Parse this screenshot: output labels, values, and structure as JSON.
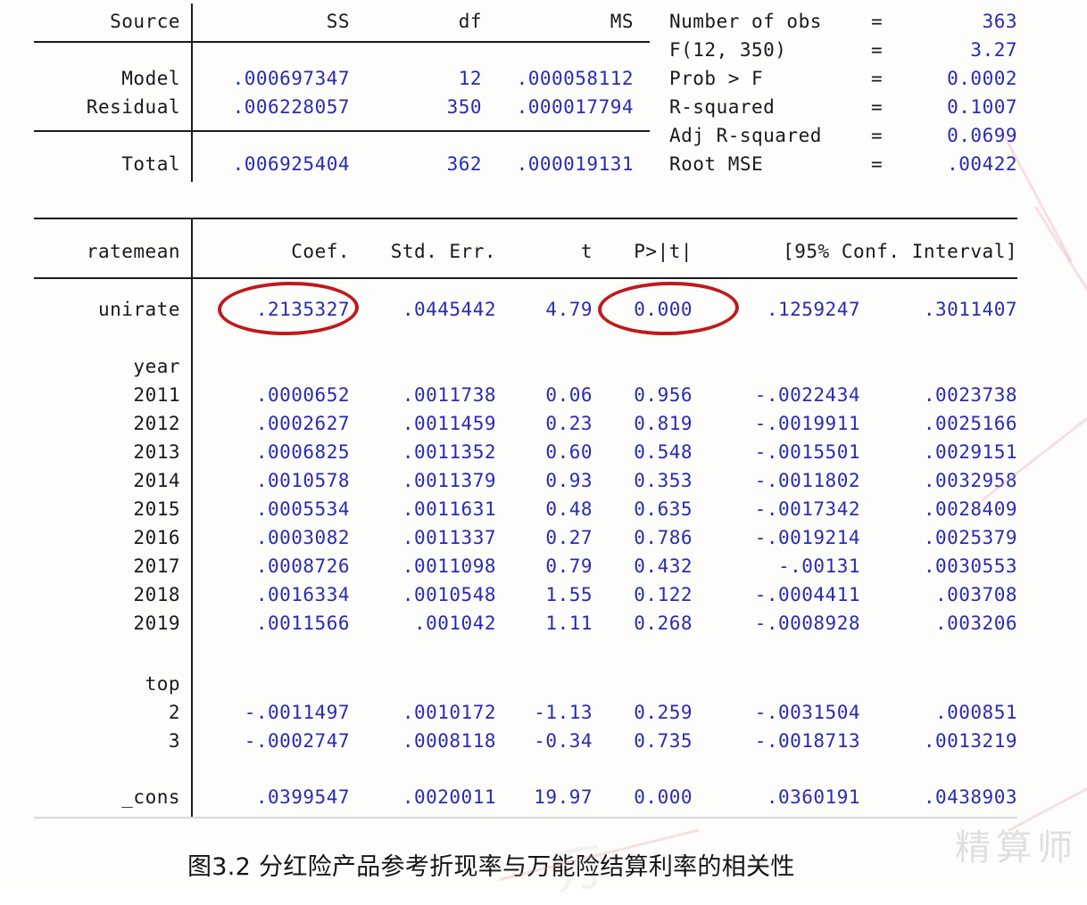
{
  "anova": {
    "headers": [
      "Source",
      "SS",
      "df",
      "MS"
    ],
    "rows": [
      {
        "source": "Model",
        "ss": ".000697347",
        "df": "12",
        "ms": ".000058112"
      },
      {
        "source": "Residual",
        "ss": ".006228057",
        "df": "350",
        "ms": ".000017794"
      },
      {
        "source": "Total",
        "ss": ".006925404",
        "df": "362",
        "ms": ".000019131"
      }
    ]
  },
  "stats": [
    {
      "label": "Number of obs",
      "eq": "=",
      "value": "363"
    },
    {
      "label": "F(12, 350)",
      "eq": "=",
      "value": "3.27"
    },
    {
      "label": "Prob > F",
      "eq": "=",
      "value": "0.0002"
    },
    {
      "label": "R-squared",
      "eq": "=",
      "value": "0.1007"
    },
    {
      "label": "Adj R-squared",
      "eq": "=",
      "value": "0.0699"
    },
    {
      "label": "Root MSE",
      "eq": "=",
      "value": ".00422"
    }
  ],
  "coef_table": {
    "depvar": "ratemean",
    "headers": [
      "Coef.",
      "Std. Err.",
      "t",
      "P>|t|",
      "[95% Conf. Interval]"
    ],
    "rows": [
      {
        "term": "unirate",
        "coef": ".2135327",
        "se": ".0445442",
        "t": "4.79",
        "p": "0.000",
        "ci_lo": ".1259247",
        "ci_hi": ".3011407"
      },
      {
        "term": "year",
        "group": true
      },
      {
        "term": "2011",
        "coef": ".0000652",
        "se": ".0011738",
        "t": "0.06",
        "p": "0.956",
        "ci_lo": "-.0022434",
        "ci_hi": ".0023738"
      },
      {
        "term": "2012",
        "coef": ".0002627",
        "se": ".0011459",
        "t": "0.23",
        "p": "0.819",
        "ci_lo": "-.0019911",
        "ci_hi": ".0025166"
      },
      {
        "term": "2013",
        "coef": ".0006825",
        "se": ".0011352",
        "t": "0.60",
        "p": "0.548",
        "ci_lo": "-.0015501",
        "ci_hi": ".0029151"
      },
      {
        "term": "2014",
        "coef": ".0010578",
        "se": ".0011379",
        "t": "0.93",
        "p": "0.353",
        "ci_lo": "-.0011802",
        "ci_hi": ".0032958"
      },
      {
        "term": "2015",
        "coef": ".0005534",
        "se": ".0011631",
        "t": "0.48",
        "p": "0.635",
        "ci_lo": "-.0017342",
        "ci_hi": ".0028409"
      },
      {
        "term": "2016",
        "coef": ".0003082",
        "se": ".0011337",
        "t": "0.27",
        "p": "0.786",
        "ci_lo": "-.0019214",
        "ci_hi": ".0025379"
      },
      {
        "term": "2017",
        "coef": ".0008726",
        "se": ".0011098",
        "t": "0.79",
        "p": "0.432",
        "ci_lo": "-.00131",
        "ci_hi": ".0030553"
      },
      {
        "term": "2018",
        "coef": ".0016334",
        "se": ".0010548",
        "t": "1.55",
        "p": "0.122",
        "ci_lo": "-.0004411",
        "ci_hi": ".003708"
      },
      {
        "term": "2019",
        "coef": ".0011566",
        "se": ".001042",
        "t": "1.11",
        "p": "0.268",
        "ci_lo": "-.0008928",
        "ci_hi": ".003206"
      },
      {
        "term": "top",
        "group": true
      },
      {
        "term": "2",
        "coef": "-.0011497",
        "se": ".0010172",
        "t": "-1.13",
        "p": "0.259",
        "ci_lo": "-.0031504",
        "ci_hi": ".000851"
      },
      {
        "term": "3",
        "coef": "-.0002747",
        "se": ".0008118",
        "t": "-0.34",
        "p": "0.735",
        "ci_lo": "-.0018713",
        "ci_hi": ".0013219"
      },
      {
        "term": "_cons",
        "coef": ".0399547",
        "se": ".0020011",
        "t": "19.97",
        "p": "0.000",
        "ci_lo": ".0360191",
        "ci_hi": ".0438903"
      }
    ]
  },
  "annotations": {
    "highlight_color": "#c0191b",
    "circled_coef": ".2135327",
    "circled_pvalue": "0.000"
  },
  "caption": {
    "text": "图3.2 分红险产品参考折现率与万能险结算利率的相关性"
  },
  "watermark": {
    "text": "精算师"
  },
  "colors": {
    "number_blue": "#2a2ab4",
    "label_black": "#19191c",
    "rule_black": "#1b1b1b"
  }
}
